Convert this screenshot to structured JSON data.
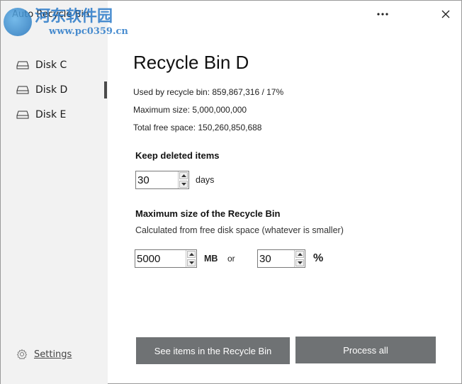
{
  "window": {
    "title": "Auto Recycle Bin",
    "more_icon": "more-horizontal-icon",
    "close_icon": "close-icon"
  },
  "watermark": {
    "line1": "河东软件园",
    "line2": "www.pc0359.cn"
  },
  "sidebar": {
    "items": [
      {
        "label": "Disk C",
        "icon": "disk-icon",
        "selected": false
      },
      {
        "label": "Disk D",
        "icon": "disk-icon",
        "selected": true
      },
      {
        "label": "Disk E",
        "icon": "disk-icon",
        "selected": false
      }
    ],
    "settings_label": "Settings",
    "settings_icon": "gear-icon"
  },
  "main": {
    "title": "Recycle Bin D",
    "used": "Used by recycle bin: 859,867,316 / 17%",
    "max_size": "Maximum size: 5,000,000,000",
    "free_space": "Total free space: 150,260,850,688",
    "keep_label": "Keep deleted items",
    "keep_value": "30",
    "keep_unit": "days",
    "max_label": "Maximum size of the Recycle Bin",
    "max_sub": "Calculated from free disk space (whatever is smaller)",
    "mb_value": "5000",
    "mb_unit": "MB",
    "or_text": "or",
    "pct_value": "30",
    "pct_unit": "%",
    "see_items_button": "See items in the Recycle Bin",
    "process_all_button": "Process all"
  }
}
